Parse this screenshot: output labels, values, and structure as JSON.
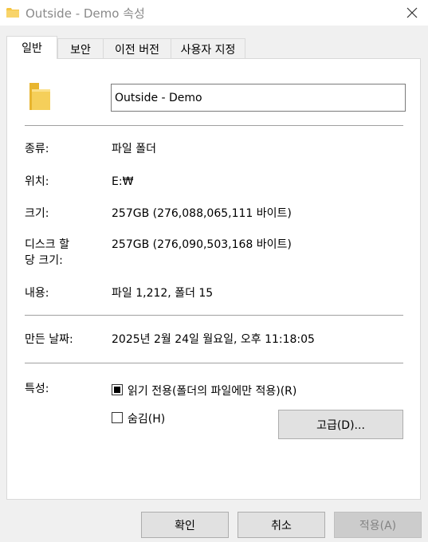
{
  "window": {
    "title": "Outside - Demo 속성"
  },
  "tabs": [
    {
      "label": "일반",
      "active": true
    },
    {
      "label": "보안",
      "active": false
    },
    {
      "label": "이전 버전",
      "active": false
    },
    {
      "label": "사용자 지정",
      "active": false
    }
  ],
  "general": {
    "folder_name": "Outside - Demo",
    "type": {
      "label": "종류:",
      "value": "파일 폴더"
    },
    "location": {
      "label": "위치:",
      "value": "E:₩"
    },
    "size": {
      "label": "크기:",
      "value": "257GB (276,088,065,111 바이트)"
    },
    "size_on_disk": {
      "label_line1": "디스크 할",
      "label_line2": "당 크기:",
      "value": "257GB (276,090,503,168 바이트)"
    },
    "contains": {
      "label": "내용:",
      "value": "파일 1,212, 폴더 15"
    },
    "created": {
      "label": "만든 날짜:",
      "value": "2025년 2월 24일 월요일, 오후 11:18:05"
    },
    "attributes": {
      "label": "특성:",
      "readonly_label": "읽기 전용(폴더의 파일에만 적용)(R)",
      "readonly_state": "indeterminate",
      "hidden_label": "숨김(H)",
      "hidden_checked": false,
      "advanced_button": "고급(D)..."
    }
  },
  "footer": {
    "ok": "확인",
    "cancel": "취소",
    "apply": "적용(A)"
  },
  "icons": {
    "title": "folder-icon",
    "close": "close-icon",
    "folder_large": "folder-icon"
  },
  "colors": {
    "folder": "#f5c542",
    "panel_bg": "#ffffff",
    "dialog_bg": "#f0f0f0",
    "button_bg": "#e1e1e1",
    "disabled_text": "#838383"
  }
}
